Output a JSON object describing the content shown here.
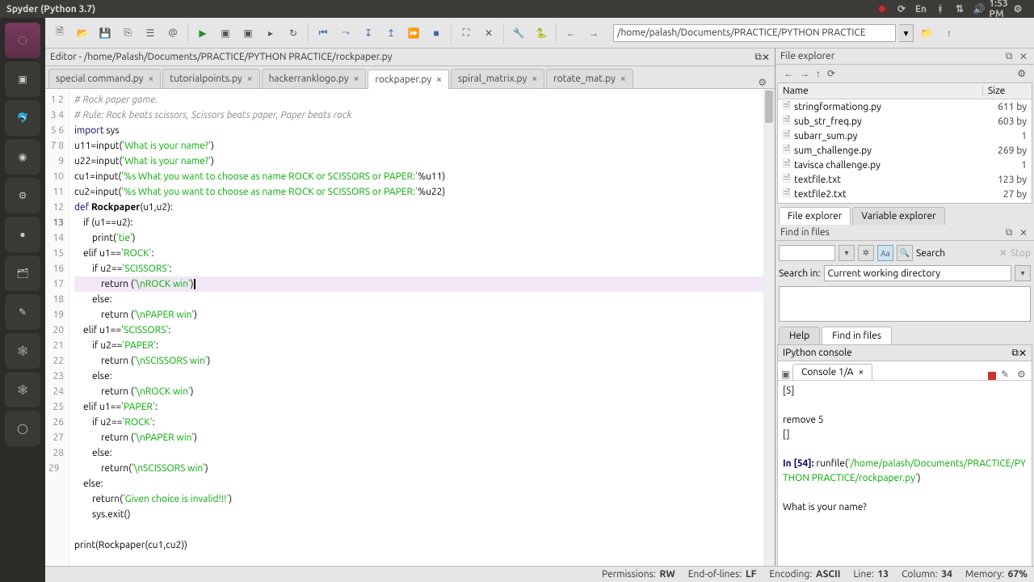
{
  "titlebar": {
    "title": "Spyder (Python 3.7)",
    "time": "1:53 PM",
    "lang": "En"
  },
  "toolbar": {
    "path": "/home/palash/Documents/PRACTICE/PYTHON PRACTICE"
  },
  "editor": {
    "header": "Editor - /home/Palash/Documents/PRACTICE/PYTHON PRACTICE/rockpaper.py",
    "tabs": [
      {
        "label": "special command.py"
      },
      {
        "label": "tutorialpoints.py"
      },
      {
        "label": "hackerranklogo.py"
      },
      {
        "label": "rockpaper.py",
        "active": true
      },
      {
        "label": "spiral_matrix.py"
      },
      {
        "label": "rotate_mat.py"
      }
    ],
    "lines": {
      "l1": "# Rock paper game.",
      "l2": "# Rule: Rock beats scissors, Scissors beats paper, Paper beats rock",
      "l3a": "import",
      "l3b": " sys",
      "l4a": "u11=input(",
      "l4b": "'What is your name?'",
      "l4c": ")",
      "l5a": "u22=input(",
      "l5b": "'What is your name?'",
      "l5c": ")",
      "l6a": "cu1=input(",
      "l6b": "'%s What you want to choose as name ROCK or SCISSORS or PAPER:'",
      "l6c": "%u11)",
      "l7a": "cu2=input(",
      "l7b": "'%s What you want to choose as name ROCK or SCISSORS or PAPER:'",
      "l7c": "%u22)",
      "l8a": "def ",
      "l8b": "Rockpaper",
      "l8c": "(u1,u2):",
      "l9": "    if (u1==u2):",
      "l10a": "        print(",
      "l10b": "'tie'",
      "l10c": ")",
      "l11a": "    elif u1==",
      "l11b": "'ROCK'",
      "l11c": ":",
      "l12a": "        if u2==",
      "l12b": "'SCISSORS'",
      "l12c": ":",
      "l13a": "            return (",
      "l13b": "'\\nROCK win'",
      "l13c": ")",
      "l14": "        else:",
      "l15a": "            return (",
      "l15b": "'\\nPAPER win'",
      "l15c": ")",
      "l16a": "    elif u1==",
      "l16b": "'SCISSORS'",
      "l16c": ":",
      "l17a": "        if u2==",
      "l17b": "'PAPER'",
      "l17c": ":",
      "l18a": "            return (",
      "l18b": "'\\nSCISSORS win'",
      "l18c": ")",
      "l19": "        else:",
      "l20a": "            return (",
      "l20b": "'\\nROCK win'",
      "l20c": ")",
      "l21a": "    elif u1==",
      "l21b": "'PAPER'",
      "l21c": ":",
      "l22a": "        if u2==",
      "l22b": "'ROCK'",
      "l22c": ":",
      "l23a": "            return (",
      "l23b": "'\\nPAPER win'",
      "l23c": ")",
      "l24": "        else:",
      "l25a": "            return(",
      "l25b": "'\\nSCISSORS win'",
      "l25c": ")",
      "l26": "    else:",
      "l27a": "        return(",
      "l27b": "'Given choice is invalid!!!'",
      "l27c": ")",
      "l28": "        sys.exit()",
      "l29": "",
      "l30": "print(Rockpaper(cu1,cu2))"
    }
  },
  "file_explorer": {
    "title": "File explorer",
    "cols": {
      "name": "Name",
      "size": "Size"
    },
    "files": [
      {
        "n": "stringformationg.py",
        "s": "611 by"
      },
      {
        "n": "sub_str_freq.py",
        "s": "603 by"
      },
      {
        "n": "subarr_sum.py",
        "s": "1"
      },
      {
        "n": "sum_challenge.py",
        "s": "269 by"
      },
      {
        "n": "tavisca challenge.py",
        "s": "1"
      },
      {
        "n": "textfile.txt",
        "s": "123 by"
      },
      {
        "n": "textfile2.txt",
        "s": "27 by"
      }
    ],
    "tabs": {
      "fe": "File explorer",
      "ve": "Variable explorer"
    }
  },
  "find": {
    "title": "Find in files",
    "search": "Search",
    "stop": "Stop",
    "search_in": "Search in:",
    "cwd": "Current working directory"
  },
  "btabs": {
    "help": "Help",
    "fif": "Find in files"
  },
  "console": {
    "title": "IPython console",
    "tab": "Console 1/A",
    "body": {
      "a": "[5]",
      "b": "remove 5",
      "c": "[]",
      "d": "In [54]: ",
      "e": "runfile(",
      "f": "'/home/palash/Documents/PRACTICE/PYTHON PRACTICE/rockpaper.py'",
      "g": ")",
      "h": "What is your name?"
    }
  },
  "statusbar": {
    "perm_l": "Permissions:",
    "perm_v": "RW",
    "eol_l": "End-of-lines:",
    "eol_v": "LF",
    "enc_l": "Encoding:",
    "enc_v": "ASCII",
    "line_l": "Line:",
    "line_v": "13",
    "col_l": "Column:",
    "col_v": "34",
    "mem_l": "Memory:",
    "mem_v": "67%"
  }
}
